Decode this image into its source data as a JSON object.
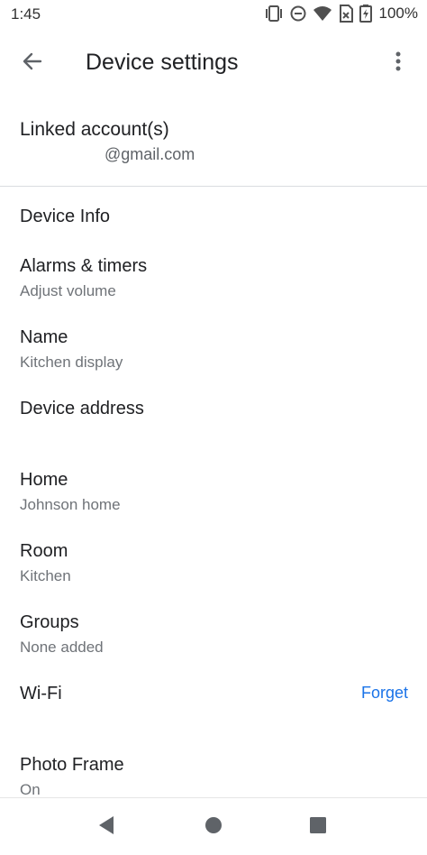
{
  "status_bar": {
    "time": "1:45",
    "battery": "100%",
    "icons": [
      "vibrate-icon",
      "do-not-disturb-icon",
      "wifi-icon",
      "sim-no-signal-icon",
      "battery-charging-icon"
    ]
  },
  "app_bar": {
    "title": "Device settings",
    "back_icon": "arrow-back-icon",
    "more_icon": "more-vert-icon"
  },
  "linked_account": {
    "label": "Linked account(s)",
    "email": "@gmail.com"
  },
  "section": {
    "header": "Device Info"
  },
  "items": [
    {
      "title": "Alarms & timers",
      "subtitle": "Adjust volume"
    },
    {
      "title": "Name",
      "subtitle": "Kitchen display"
    },
    {
      "title": "Device address",
      "subtitle": ""
    },
    {
      "title": "Home",
      "subtitle": "Johnson home"
    },
    {
      "title": "Room",
      "subtitle": "Kitchen"
    },
    {
      "title": "Groups",
      "subtitle": "None added"
    },
    {
      "title": "Wi-Fi",
      "subtitle": "",
      "action": "Forget"
    },
    {
      "title": "Photo Frame",
      "subtitle": "On"
    }
  ],
  "nav_bar": {
    "icons": [
      "nav-back-icon",
      "nav-home-icon",
      "nav-recents-icon"
    ]
  },
  "colors": {
    "accent": "#1a73e8",
    "text_primary": "#202124",
    "text_secondary": "#6f7378",
    "divider": "#dadce0"
  }
}
